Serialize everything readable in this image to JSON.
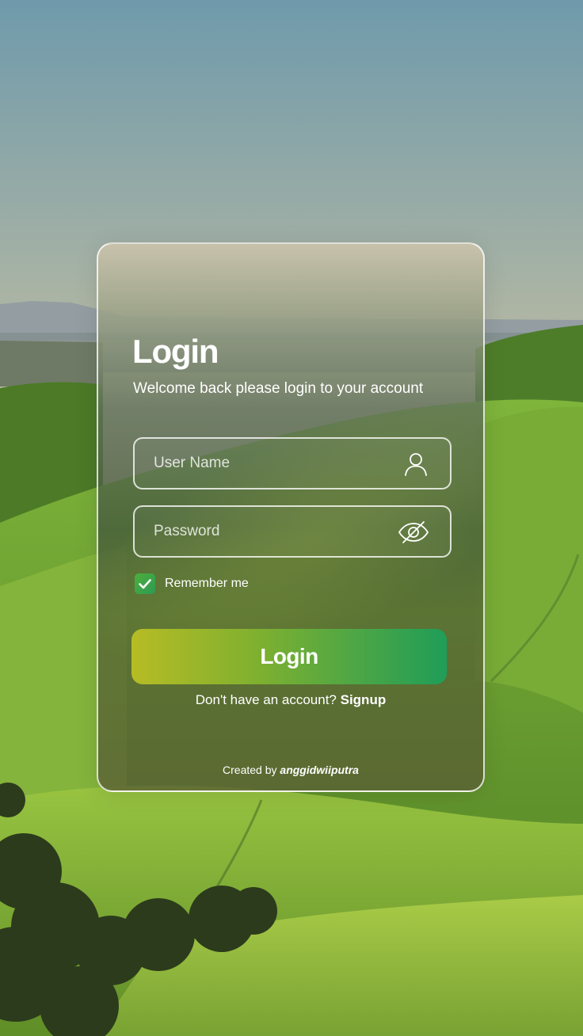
{
  "login": {
    "title": "Login",
    "subtitle": "Welcome back please login to your account",
    "username": {
      "value": "",
      "placeholder": "User Name",
      "icon": "user-icon"
    },
    "password": {
      "value": "",
      "placeholder": "Password",
      "icon": "eye-off-icon"
    },
    "remember": {
      "label": "Remember me",
      "checked": true
    },
    "submit_label": "Login",
    "signup_prompt": "Don't have an account?",
    "signup_link": "Signup",
    "credit_prefix": "Created by",
    "credit_author": "anggidwiiputra"
  },
  "colors": {
    "accent_start": "#b6bc24",
    "accent_end": "#1f9d58",
    "checkbox": "#3fa64a",
    "text": "#ffffff"
  }
}
